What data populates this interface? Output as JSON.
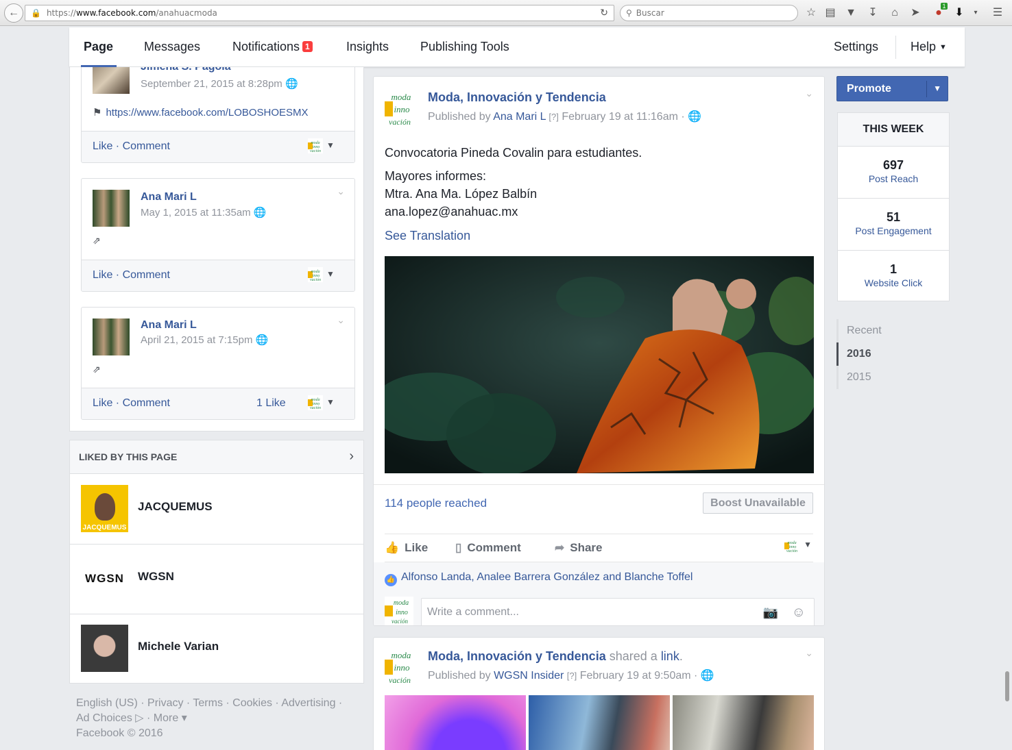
{
  "browser": {
    "url_prefix": "https://",
    "url_host": "www.facebook.com",
    "url_path": "/anahuacmoda",
    "search_placeholder": "Buscar",
    "extension_badge": "1"
  },
  "nav": {
    "tabs": [
      "Page",
      "Messages",
      "Notifications",
      "Insights",
      "Publishing Tools"
    ],
    "notifications_count": "1",
    "settings": "Settings",
    "help": "Help"
  },
  "left_posts": [
    {
      "name": "Jimena S. Pagola",
      "date": "September 21, 2015 at 8:28pm",
      "link": "https://www.facebook.com/LOBOSHOESMX",
      "actions": "Like · Comment",
      "likes": ""
    },
    {
      "name": "Ana Mari L",
      "date": "May 1, 2015 at 11:35am",
      "actions": "Like · Comment",
      "likes": ""
    },
    {
      "name": "Ana Mari L",
      "date": "April 21, 2015 at 7:15pm",
      "actions": "Like · Comment",
      "likes": "1 Like"
    }
  ],
  "liked_by": {
    "title": "LIKED BY THIS PAGE",
    "pages": [
      {
        "name": "JACQUEMUS",
        "thumb_text": "JACQUEMUS"
      },
      {
        "name": "WGSN",
        "thumb_text": "WGSN"
      },
      {
        "name": "Michele Varian",
        "thumb_text": ""
      }
    ]
  },
  "footer": {
    "line1": "English (US) · Privacy · Terms · Cookies · Advertising ·",
    "line2": "Ad Choices ▷ · More ▾",
    "line3": "Facebook © 2016"
  },
  "main_post": {
    "page_name": "Moda, Innovación y Tendencia",
    "published_label": "Published by",
    "published_by": "Ana Mari L",
    "question": "[?]",
    "date": "February 19 at 11:16am ·",
    "text_line1": "Convocatoria Pineda Covalin para estudiantes.",
    "text_line2": "Mayores informes:",
    "text_line3": "Mtra. Ana Ma. López Balbín",
    "text_line4": "ana.lopez@anahuac.mx",
    "see_translation": "See Translation",
    "reached": "114 people reached",
    "boost": "Boost Unavailable",
    "actions": [
      "Like",
      "Comment",
      "Share"
    ],
    "likers": "Alfonso Landa, Analee Barrera González and Blanche Toffel",
    "comment_placeholder": "Write a comment..."
  },
  "second_post": {
    "page_name": "Moda, Innovación y Tendencia",
    "shared": "shared a",
    "shared_link": "link",
    "published_label": "Published by",
    "published_by": "WGSN Insider",
    "question": "[?]",
    "date": "February 19 at 9:50am ·"
  },
  "page_logo_text": [
    "moda",
    "inno",
    "vación"
  ],
  "right": {
    "promote": "Promote",
    "this_week": "THIS WEEK",
    "stats": [
      {
        "num": "697",
        "label": "Post Reach"
      },
      {
        "num": "51",
        "label": "Post Engagement"
      },
      {
        "num": "1",
        "label": "Website Click"
      }
    ],
    "timeline": [
      "Recent",
      "2016",
      "2015"
    ]
  },
  "colors": {
    "fb_blue": "#4267b2",
    "link_blue": "#365899",
    "badge_red": "#fa3e3e"
  }
}
